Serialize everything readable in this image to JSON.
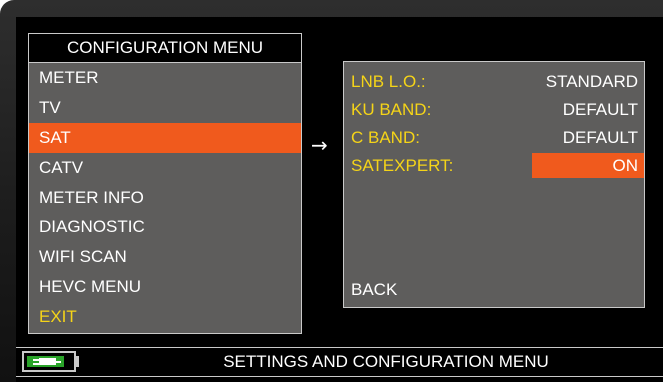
{
  "config_menu": {
    "title": "CONFIGURATION MENU",
    "items": [
      {
        "label": "METER"
      },
      {
        "label": "TV"
      },
      {
        "label": "SAT",
        "selected": true
      },
      {
        "label": "CATV"
      },
      {
        "label": "METER INFO"
      },
      {
        "label": "DIAGNOSTIC"
      },
      {
        "label": "WIFI SCAN"
      },
      {
        "label": "HEVC MENU"
      },
      {
        "label": "EXIT"
      }
    ]
  },
  "arrow_glyph": "→",
  "sat_submenu": {
    "rows": [
      {
        "label": "LNB L.O.:",
        "value": "STANDARD"
      },
      {
        "label": "KU BAND:",
        "value": "DEFAULT"
      },
      {
        "label": "C BAND:",
        "value": "DEFAULT"
      },
      {
        "label": "SATEXPERT:",
        "value": "ON"
      }
    ],
    "back_label": "BACK"
  },
  "status_bar": {
    "text": "SETTINGS AND CONFIGURATION MENU",
    "battery_icon": "battery-charging-icon"
  },
  "colors": {
    "selection": "#f05a1d",
    "label_yellow": "#f5d418",
    "panel_gray": "#5e5d5c",
    "battery_green": "#29a329"
  }
}
